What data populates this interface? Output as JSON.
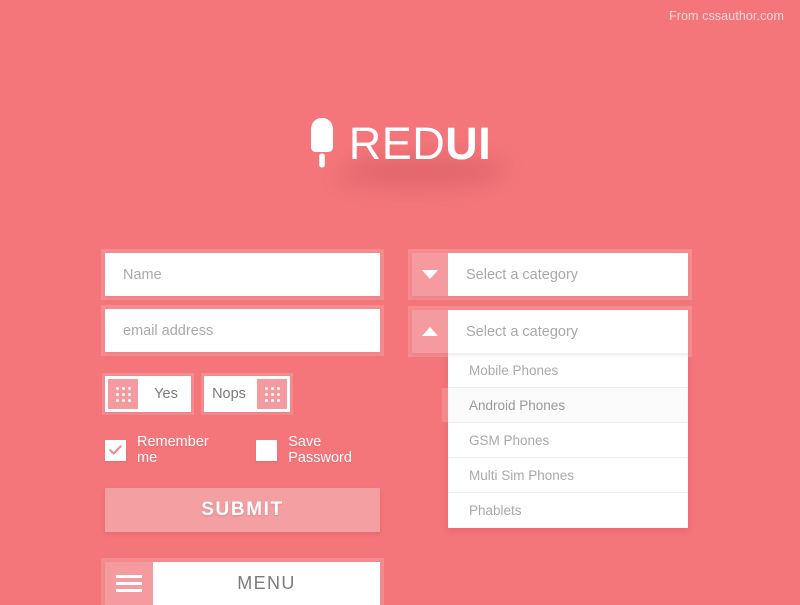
{
  "attribution": "From cssauthor.com",
  "theme": {
    "background": "#f4767b",
    "accent_light": "#f59ba0",
    "submit_bg": "#f4a0a3",
    "white": "#ffffff",
    "option_accent": "#f4888d"
  },
  "logo": {
    "icon": "popsicle-icon",
    "text_light": "RED",
    "text_bold": "UI"
  },
  "form": {
    "name_field": {
      "value": "",
      "placeholder": "Name"
    },
    "email_field": {
      "value": "",
      "placeholder": "email address"
    },
    "toggles": [
      {
        "label": "Yes",
        "handle_side": "left",
        "icon": "grip-dots-icon"
      },
      {
        "label": "Nops",
        "handle_side": "right",
        "icon": "grip-dots-icon"
      }
    ],
    "checkboxes": [
      {
        "label": "Remember me",
        "checked": true
      },
      {
        "label": "Save Password",
        "checked": false
      }
    ],
    "submit_label": "SUBMIT",
    "menu": {
      "label": "MENU",
      "icon": "hamburger-icon"
    }
  },
  "selects": [
    {
      "value": "Select a category",
      "state": "collapsed",
      "arrow": "chevron-down-icon"
    },
    {
      "value": "Select a category",
      "state": "expanded",
      "arrow": "chevron-up-icon"
    }
  ],
  "dropdown": {
    "options": [
      {
        "label": "Mobile Phones",
        "active": false
      },
      {
        "label": "Android Phones",
        "active": true
      },
      {
        "label": "GSM Phones",
        "active": false
      },
      {
        "label": "Multi Sim Phones",
        "active": false
      },
      {
        "label": "Phablets",
        "active": false
      }
    ]
  }
}
